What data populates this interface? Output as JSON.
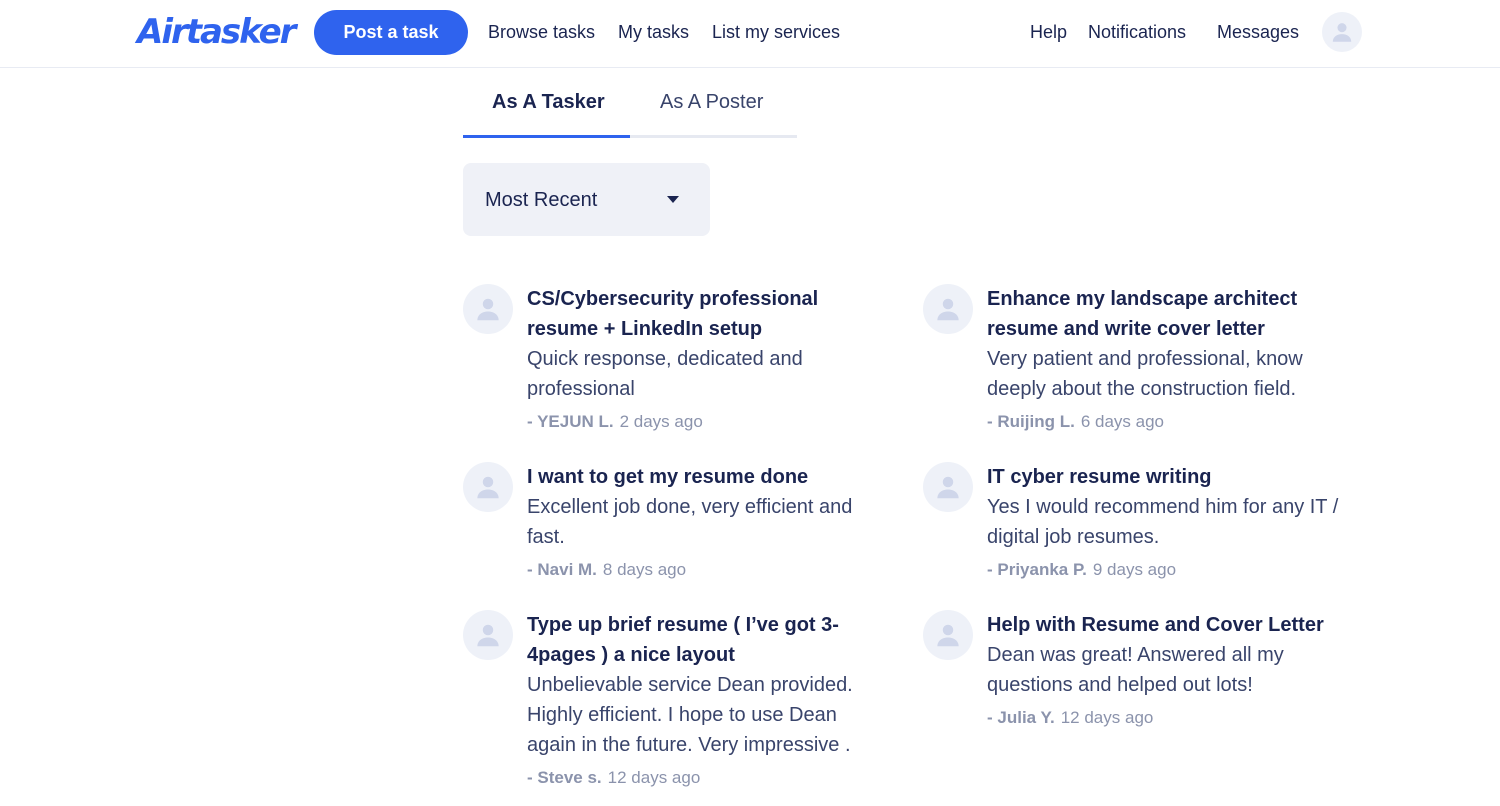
{
  "header": {
    "logo_text": "Airtasker",
    "post_task_label": "Post a task",
    "nav_left": [
      "Browse tasks",
      "My tasks",
      "List my services"
    ],
    "nav_right": [
      "Help",
      "Notifications",
      "Messages"
    ]
  },
  "tabs": [
    {
      "label": "As A Tasker",
      "active": true
    },
    {
      "label": "As A Poster",
      "active": false
    }
  ],
  "sort": {
    "selected": "Most Recent"
  },
  "reviews": [
    {
      "title": "CS/Cybersecurity professional resume + LinkedIn setup",
      "text": "Quick response, dedicated and professional",
      "author": "- YEJUN L.",
      "time": "2 days ago"
    },
    {
      "title": "Enhance my landscape architect resume and write cover letter",
      "text": "Very patient and professional, know deeply about the construction field.",
      "author": "- Ruijing L.",
      "time": "6 days ago"
    },
    {
      "title": "I want to get my resume done",
      "text": "Excellent job done, very efficient and fast.",
      "author": "- Navi M.",
      "time": "8 days ago"
    },
    {
      "title": "IT cyber resume writing",
      "text": "Yes I would recommend him for any IT / digital job resumes.",
      "author": "- Priyanka P.",
      "time": "9 days ago"
    },
    {
      "title": "Type up brief resume ( I’ve got 3-4pages ) a nice layout",
      "text": "Unbelievable service Dean provided. Highly efficient. I hope to use Dean again in the future. Very impressive .",
      "author": "- Steve s.",
      "time": "12 days ago"
    },
    {
      "title": "Help with Resume and Cover Letter",
      "text": "Dean was great! Answered all my questions and helped out lots!",
      "author": "- Julia Y.",
      "time": "12 days ago"
    }
  ],
  "colors": {
    "brand": "#2f63ee",
    "text": "#1a2450",
    "muted": "#8b93ac"
  },
  "icons": {
    "avatar": "user-avatar-icon",
    "dropdown": "caret-down-icon"
  }
}
